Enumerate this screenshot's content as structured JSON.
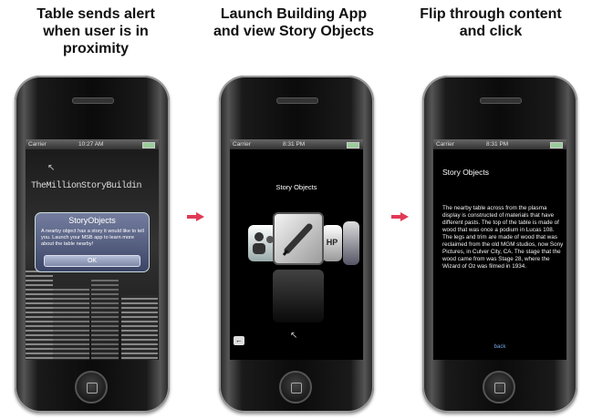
{
  "captions": {
    "step1": [
      "Table sends alert",
      "when  user is in",
      "proximity"
    ],
    "step2": [
      "Launch Building App",
      "and view Story Objects"
    ],
    "step3": [
      "Flip through content",
      "and click"
    ]
  },
  "phone1": {
    "status": {
      "carrier": "Carrier",
      "time": "10:27 AM"
    },
    "brand_text": "TheMillionStoryBuildin",
    "alert": {
      "title": "StoryObjects",
      "body": "A nearby object has a story it would like to tell you. Launch your MSB app to learn more about the table nearby!",
      "ok_label": "OK"
    }
  },
  "phone2": {
    "status": {
      "carrier": "Carrier",
      "time": "8:31 PM"
    },
    "title": "Story Objects",
    "right_card_text": "HP"
  },
  "phone3": {
    "status": {
      "carrier": "Carrier",
      "time": "8:31 PM"
    },
    "title": "Story Objects",
    "paragraph1": "The nearby table across from the plasma display is constructed of materials that have different pasts. The top of the table is made of wood that was once a podium in Lucas 108.",
    "paragraph2": "The legs and trim are made of wood that was reclaimed from the old MGM studios, now Sony Pictures, in Culver City, CA. The stage that the wood came from was Stage 28, where the Wizard of Oz was filmed in 1934.",
    "back_label": "back"
  },
  "icons": {
    "arrows": "right-arrow-icon",
    "cursor": "cursor-icon",
    "pen": "pen-icon",
    "back": "back-arrow-icon"
  },
  "colors": {
    "arrow": "#e03a57",
    "alert": "#5b6690",
    "link": "#7aa8e8"
  }
}
